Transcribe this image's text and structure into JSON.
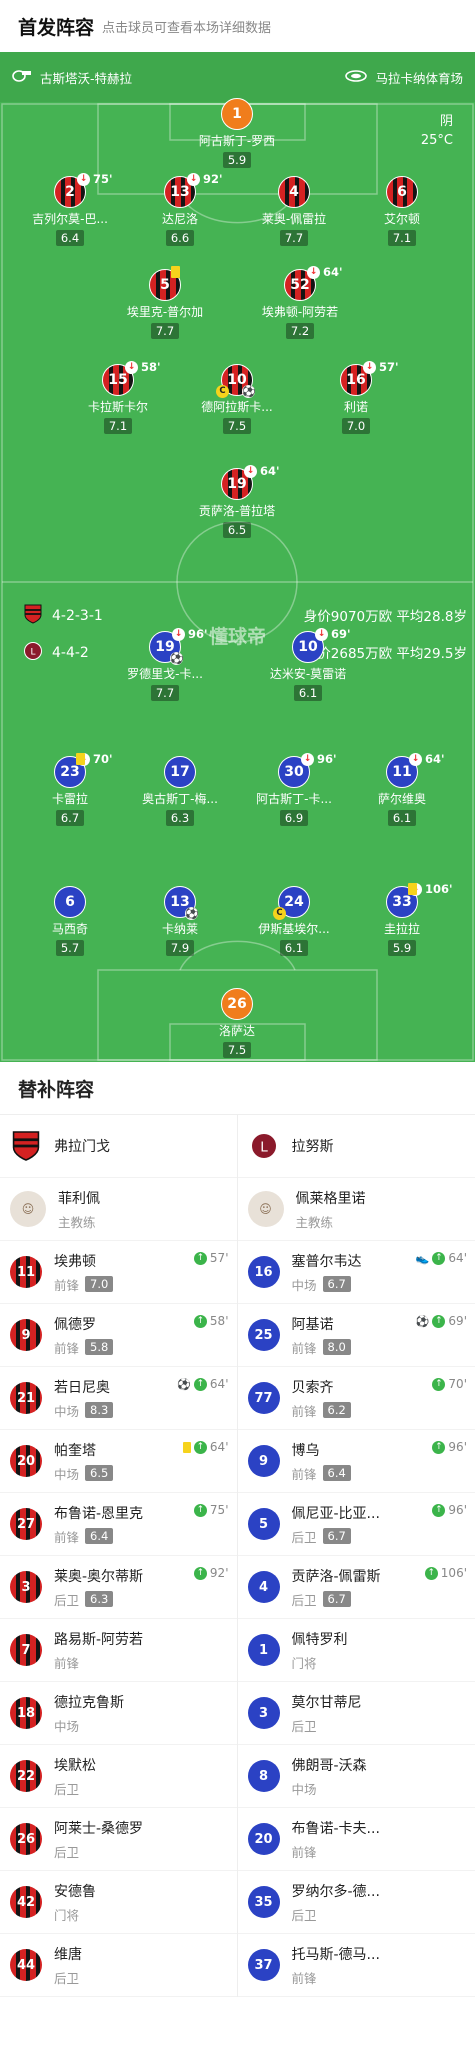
{
  "header": {
    "title": "首发阵容",
    "subtitle": "点击球员可查看本场详细数据"
  },
  "match": {
    "referee": "古斯塔沃-特赫拉",
    "venue": "马拉卡纳体育场",
    "weather": "阴",
    "temperature": "25°C",
    "logo": "懂球帝"
  },
  "home": {
    "formation": "4-2-3-1",
    "value": "身价9070万欧 平均28.8岁",
    "color": "#d42222"
  },
  "away": {
    "formation": "4-4-2",
    "value": "身价2685万欧 平均29.5岁",
    "color": "#2b42c4"
  },
  "home_players": [
    {
      "num": "1",
      "name": "阿古斯丁-罗西",
      "rating": "5.9",
      "sub": "",
      "card": false,
      "ball": false,
      "captain": false,
      "kit": "orange"
    },
    {
      "num": "2",
      "name": "吉列尔莫-巴...",
      "rating": "6.4",
      "sub": "75'",
      "card": false,
      "ball": false,
      "captain": false,
      "kit": "red"
    },
    {
      "num": "13",
      "name": "达尼洛",
      "rating": "6.6",
      "sub": "92'",
      "card": false,
      "ball": false,
      "captain": false,
      "kit": "red"
    },
    {
      "num": "4",
      "name": "莱奥-佩雷拉",
      "rating": "7.7",
      "sub": "",
      "card": false,
      "ball": false,
      "captain": false,
      "kit": "red"
    },
    {
      "num": "6",
      "name": "艾尔顿",
      "rating": "7.1",
      "sub": "",
      "card": false,
      "ball": false,
      "captain": false,
      "kit": "red"
    },
    {
      "num": "5",
      "name": "埃里克-普尔加",
      "rating": "7.7",
      "sub": "",
      "card": true,
      "ball": false,
      "captain": false,
      "kit": "red"
    },
    {
      "num": "52",
      "name": "埃弗顿-阿劳若",
      "rating": "7.2",
      "sub": "64'",
      "card": false,
      "ball": false,
      "captain": false,
      "kit": "red"
    },
    {
      "num": "15",
      "name": "卡拉斯卡尔",
      "rating": "7.1",
      "sub": "58'",
      "card": false,
      "ball": false,
      "captain": false,
      "kit": "red"
    },
    {
      "num": "10",
      "name": "德阿拉斯卡...",
      "rating": "7.5",
      "sub": "",
      "card": false,
      "ball": true,
      "captain": true,
      "kit": "red"
    },
    {
      "num": "16",
      "name": "利诺",
      "rating": "7.0",
      "sub": "57'",
      "card": false,
      "ball": false,
      "captain": false,
      "kit": "red"
    },
    {
      "num": "19",
      "name": "贡萨洛-普拉塔",
      "rating": "6.5",
      "sub": "64'",
      "card": false,
      "ball": false,
      "captain": false,
      "kit": "red"
    }
  ],
  "away_players": [
    {
      "num": "19",
      "name": "罗德里戈-卡...",
      "rating": "7.7",
      "sub": "96'",
      "card": false,
      "ball": true,
      "captain": false,
      "kit": "blue"
    },
    {
      "num": "10",
      "name": "达米安-莫雷诺",
      "rating": "6.1",
      "sub": "69'",
      "card": false,
      "ball": false,
      "captain": false,
      "kit": "blue"
    },
    {
      "num": "23",
      "name": "卡雷拉",
      "rating": "6.7",
      "sub": "70'",
      "card": true,
      "ball": false,
      "captain": false,
      "kit": "blue"
    },
    {
      "num": "17",
      "name": "奥古斯丁-梅...",
      "rating": "6.3",
      "sub": "",
      "card": false,
      "ball": false,
      "captain": false,
      "kit": "blue"
    },
    {
      "num": "30",
      "name": "阿古斯丁-卡...",
      "rating": "6.9",
      "sub": "96'",
      "card": false,
      "ball": false,
      "captain": false,
      "kit": "blue"
    },
    {
      "num": "11",
      "name": "萨尔维奥",
      "rating": "6.1",
      "sub": "64'",
      "card": false,
      "ball": false,
      "captain": false,
      "kit": "blue"
    },
    {
      "num": "6",
      "name": "马西奇",
      "rating": "5.7",
      "sub": "",
      "card": false,
      "ball": false,
      "captain": false,
      "kit": "blue"
    },
    {
      "num": "13",
      "name": "卡纳莱",
      "rating": "7.9",
      "sub": "",
      "card": false,
      "ball": true,
      "captain": false,
      "kit": "blue"
    },
    {
      "num": "24",
      "name": "伊斯基埃尔...",
      "rating": "6.1",
      "sub": "",
      "card": false,
      "ball": false,
      "captain": true,
      "kit": "blue"
    },
    {
      "num": "33",
      "name": "圭拉拉",
      "rating": "5.9",
      "sub": "106'",
      "card": true,
      "ball": false,
      "captain": false,
      "kit": "blue"
    },
    {
      "num": "26",
      "name": "洛萨达",
      "rating": "7.5",
      "sub": "",
      "card": false,
      "ball": false,
      "captain": false,
      "kit": "orange"
    }
  ],
  "subs": {
    "title": "替补阵容",
    "home_team": "弗拉门戈",
    "away_team": "拉努斯",
    "home_coach": {
      "name": "菲利佩",
      "role": "主教练",
      "avatar": "coach"
    },
    "away_coach": {
      "name": "佩莱格里诺",
      "role": "主教练",
      "avatar": "coach"
    },
    "home": [
      {
        "num": "11",
        "name": "埃弗顿",
        "pos": "前锋",
        "rating": "7.0",
        "time": "57'",
        "icons": [
          "sub"
        ]
      },
      {
        "num": "9",
        "name": "佩德罗",
        "pos": "前锋",
        "rating": "5.8",
        "time": "58'",
        "icons": [
          "sub"
        ]
      },
      {
        "num": "21",
        "name": "若日尼奥",
        "pos": "中场",
        "rating": "8.3",
        "time": "64'",
        "icons": [
          "ball",
          "sub"
        ]
      },
      {
        "num": "20",
        "name": "帕奎塔",
        "pos": "中场",
        "rating": "6.5",
        "time": "64'",
        "icons": [
          "card",
          "sub"
        ]
      },
      {
        "num": "27",
        "name": "布鲁诺-恩里克",
        "pos": "前锋",
        "rating": "6.4",
        "time": "75'",
        "icons": [
          "sub"
        ]
      },
      {
        "num": "3",
        "name": "莱奥-奥尔蒂斯",
        "pos": "后卫",
        "rating": "6.3",
        "time": "92'",
        "icons": [
          "sub"
        ]
      },
      {
        "num": "7",
        "name": "路易斯-阿劳若",
        "pos": "前锋",
        "rating": "",
        "time": "",
        "icons": []
      },
      {
        "num": "18",
        "name": "德拉克鲁斯",
        "pos": "中场",
        "rating": "",
        "time": "",
        "icons": []
      },
      {
        "num": "22",
        "name": "埃默松",
        "pos": "后卫",
        "rating": "",
        "time": "",
        "icons": []
      },
      {
        "num": "26",
        "name": "阿莱士-桑德罗",
        "pos": "后卫",
        "rating": "",
        "time": "",
        "icons": []
      },
      {
        "num": "42",
        "name": "安德鲁",
        "pos": "门将",
        "rating": "",
        "time": "",
        "icons": []
      },
      {
        "num": "44",
        "name": "维唐",
        "pos": "后卫",
        "rating": "",
        "time": "",
        "icons": []
      }
    ],
    "away": [
      {
        "num": "16",
        "name": "塞普尔韦达",
        "pos": "中场",
        "rating": "6.7",
        "time": "64'",
        "icons": [
          "boot",
          "sub"
        ]
      },
      {
        "num": "25",
        "name": "阿基诺",
        "pos": "前锋",
        "rating": "8.0",
        "time": "69'",
        "icons": [
          "ball",
          "sub"
        ]
      },
      {
        "num": "77",
        "name": "贝索齐",
        "pos": "前锋",
        "rating": "6.2",
        "time": "70'",
        "icons": [
          "sub"
        ]
      },
      {
        "num": "9",
        "name": "博乌",
        "pos": "前锋",
        "rating": "6.4",
        "time": "96'",
        "icons": [
          "sub"
        ]
      },
      {
        "num": "5",
        "name": "佩尼亚-比亚...",
        "pos": "后卫",
        "rating": "6.7",
        "time": "96'",
        "icons": [
          "sub"
        ]
      },
      {
        "num": "4",
        "name": "贡萨洛-佩雷斯",
        "pos": "后卫",
        "rating": "6.7",
        "time": "106'",
        "icons": [
          "sub"
        ]
      },
      {
        "num": "1",
        "name": "佩特罗利",
        "pos": "门将",
        "rating": "",
        "time": "",
        "icons": []
      },
      {
        "num": "3",
        "name": "莫尔甘蒂尼",
        "pos": "后卫",
        "rating": "",
        "time": "",
        "icons": []
      },
      {
        "num": "8",
        "name": "佛朗哥-沃森",
        "pos": "中场",
        "rating": "",
        "time": "",
        "icons": []
      },
      {
        "num": "20",
        "name": "布鲁诺-卡夫...",
        "pos": "前锋",
        "rating": "",
        "time": "",
        "icons": []
      },
      {
        "num": "35",
        "name": "罗纳尔多-德...",
        "pos": "后卫",
        "rating": "",
        "time": "",
        "icons": []
      },
      {
        "num": "37",
        "name": "托马斯-德马...",
        "pos": "前锋",
        "rating": "",
        "time": "",
        "icons": []
      }
    ]
  }
}
